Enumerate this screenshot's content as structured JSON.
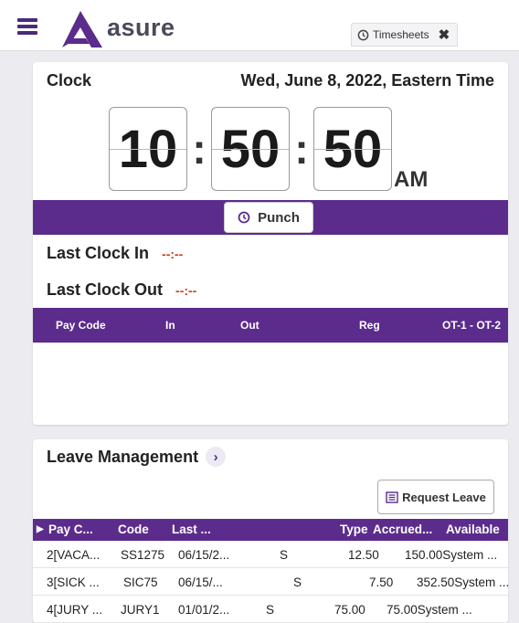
{
  "header": {
    "logo_text": "asure",
    "tab_label": "Timesheets",
    "tab_close": "✖"
  },
  "clock": {
    "title": "Clock",
    "date": "Wed, June 8, 2022, Eastern Time",
    "hours": "10",
    "minutes": "50",
    "seconds": "50",
    "colon": ":",
    "ampm": "AM",
    "punch_label": "Punch",
    "last_in_label": "Last Clock In",
    "last_in_value": "--:--",
    "last_out_label": "Last Clock Out",
    "last_out_value": "--:--",
    "table_headers": [
      "Pay Code",
      "In",
      "Out",
      "Reg",
      "OT-1 - OT-2"
    ]
  },
  "leave": {
    "title": "Leave Management",
    "request_label": "Request Leave",
    "headers": [
      "Pay C...",
      "Code",
      "Last ...",
      "Type",
      "Accrued...",
      "Available"
    ],
    "rows": [
      {
        "idx": "2[VACA...",
        "code": "SS1275",
        "last": "06/15/2...",
        "type": "S",
        "accrued": "12.50",
        "available": "150.00System ..."
      },
      {
        "idx": "3[SICK ...",
        "code": "SIC75",
        "last": "06/15/...",
        "type": "S",
        "accrued": "7.50",
        "available": "352.50System ..."
      },
      {
        "idx": "4[JURY ...",
        "code": "JURY1",
        "last": "01/01/2...",
        "type": "S",
        "accrued": "75.00",
        "available": "75.00System ..."
      }
    ]
  },
  "colors": {
    "accent_purple": "#5b2c8c",
    "time_red": "#d9381e"
  }
}
